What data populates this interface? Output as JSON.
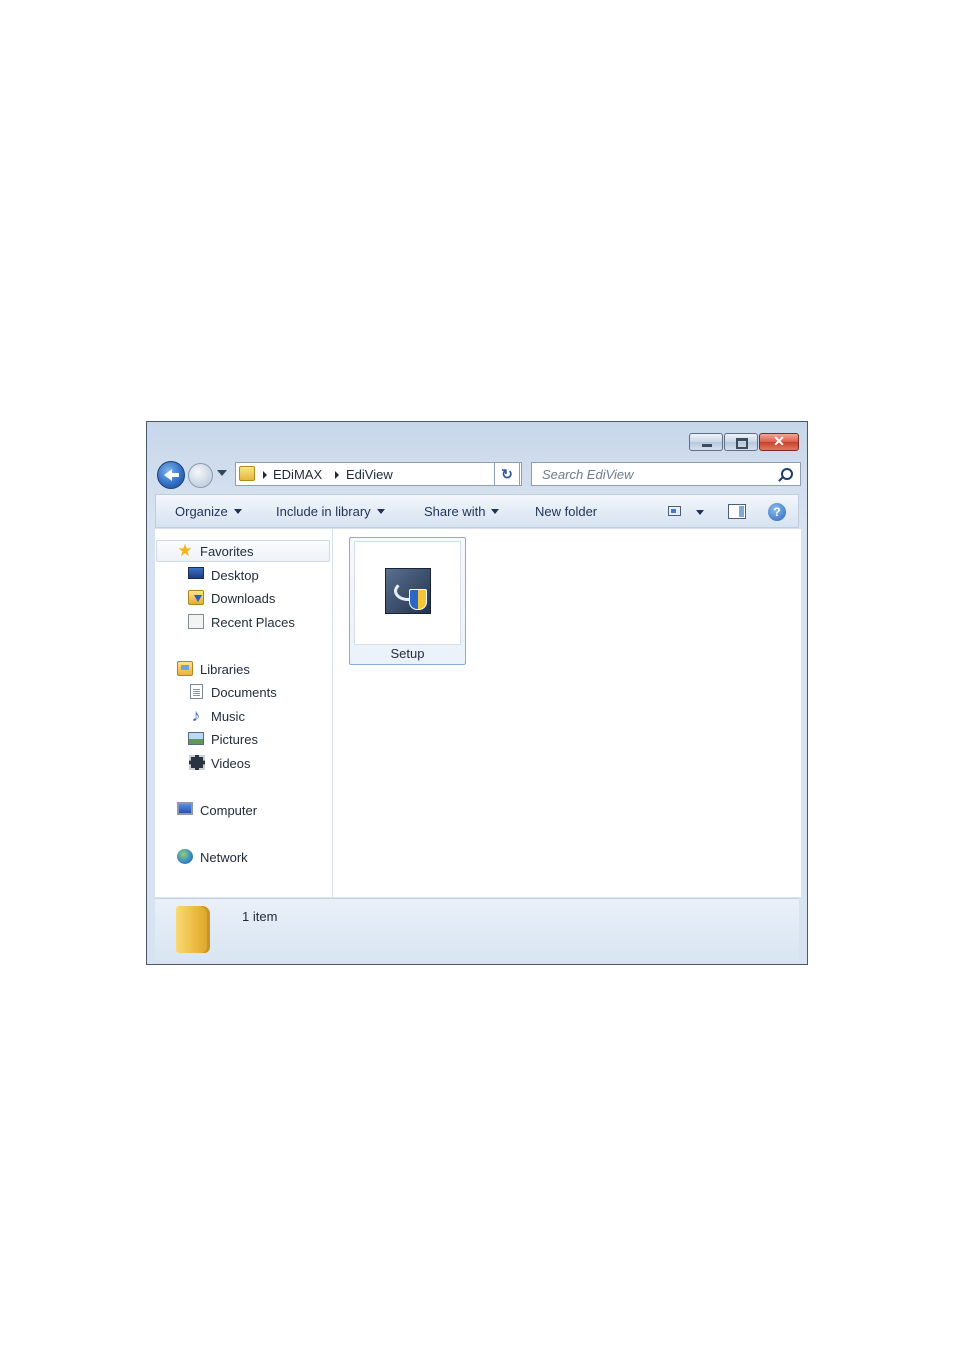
{
  "window": {
    "caption": {
      "close_glyph": "✕"
    }
  },
  "nav": {
    "breadcrumbs": [
      "EDiMAX",
      "EdiView"
    ],
    "refresh_glyph": "↻",
    "search_placeholder": "Search EdiView"
  },
  "toolbar": {
    "organize": "Organize",
    "include_in_library": "Include in library",
    "share_with": "Share with",
    "new_folder": "New folder",
    "help_glyph": "?"
  },
  "sidebar": {
    "favorites": {
      "label": "Favorites",
      "items": [
        {
          "label": "Desktop",
          "icon": "desktop-icon"
        },
        {
          "label": "Downloads",
          "icon": "downloads-icon"
        },
        {
          "label": "Recent Places",
          "icon": "recent-places-icon"
        }
      ]
    },
    "libraries": {
      "label": "Libraries",
      "items": [
        {
          "label": "Documents",
          "icon": "documents-icon"
        },
        {
          "label": "Music",
          "icon": "music-icon"
        },
        {
          "label": "Pictures",
          "icon": "pictures-icon"
        },
        {
          "label": "Videos",
          "icon": "videos-icon"
        }
      ]
    },
    "computer": {
      "label": "Computer"
    },
    "network": {
      "label": "Network"
    }
  },
  "content": {
    "files": [
      {
        "name": "Setup",
        "icon": "setup-installer-icon"
      }
    ]
  },
  "details": {
    "count": "1 item"
  }
}
